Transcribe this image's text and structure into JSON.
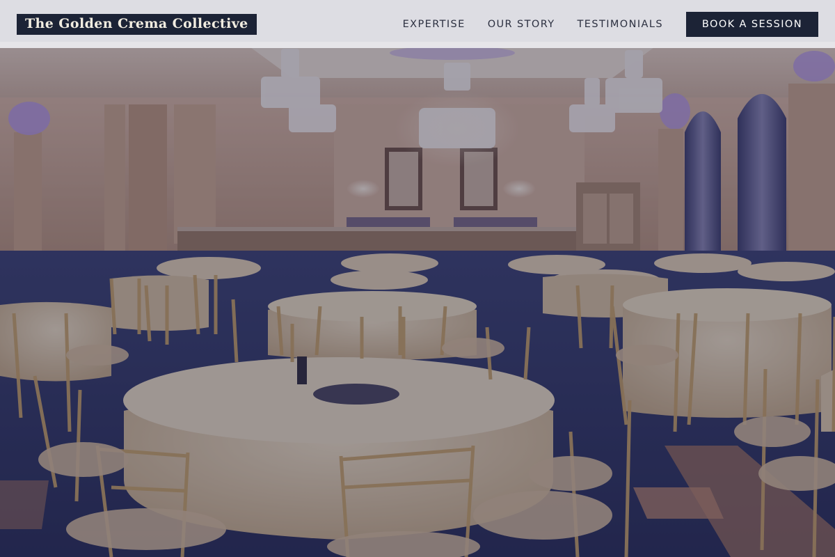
{
  "brand": {
    "name": "The Golden Crema Collective"
  },
  "nav": {
    "links": [
      {
        "label": "EXPERTISE"
      },
      {
        "label": "OUR STORY"
      },
      {
        "label": "TESTIMONIALS"
      }
    ],
    "cta_label": "BOOK A SESSION"
  },
  "colors": {
    "header_background": "#ECECF0",
    "brand_background": "#1C2336",
    "cta_background": "#1C2336",
    "overlay": "#1E1C3A"
  },
  "hero": {
    "image_subject": "ballroom-photo"
  }
}
